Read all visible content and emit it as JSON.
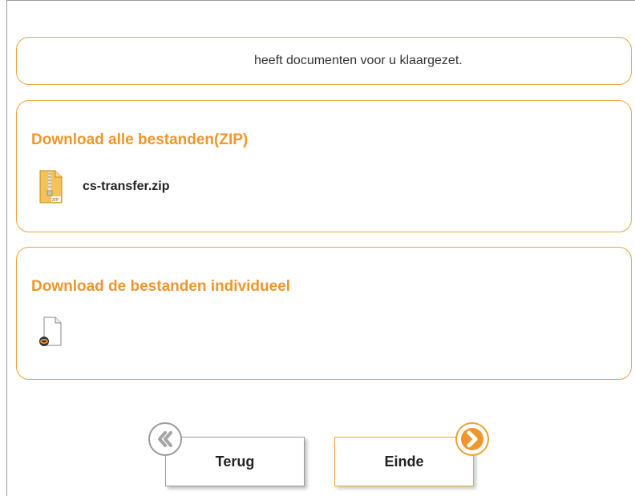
{
  "info": {
    "text": "heeft documenten voor u klaargezet."
  },
  "zip_section": {
    "title": "Download alle bestanden(ZIP)",
    "file": {
      "name": "cs-transfer.zip",
      "icon": "zip-file-icon"
    }
  },
  "individual_section": {
    "title": "Download de bestanden individueel",
    "file": {
      "name": "",
      "icon": "link-file-icon"
    }
  },
  "nav": {
    "back_label": "Terug",
    "back_icon": "chevron-left-double-icon",
    "end_label": "Einde",
    "end_icon": "chevron-right-icon"
  },
  "colors": {
    "accent": "#f0962b",
    "border": "#f0a136",
    "neutral": "#9b9b9b"
  }
}
